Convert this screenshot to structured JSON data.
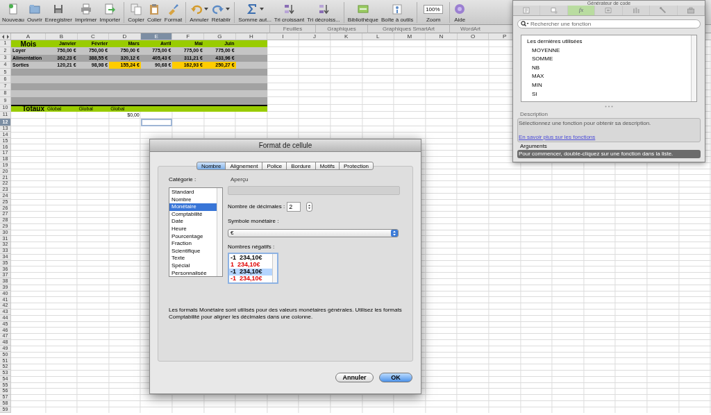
{
  "toolbar": {
    "buttons": [
      {
        "label": "Nouveau",
        "menu": false
      },
      {
        "label": "Ouvrir",
        "menu": false
      },
      {
        "label": "Enregistrer",
        "menu": false
      },
      {
        "label": "Imprimer",
        "menu": false
      },
      {
        "label": "Importer",
        "menu": false
      },
      {
        "label": "Copier",
        "menu": false
      },
      {
        "label": "Coller",
        "menu": false
      },
      {
        "label": "Format",
        "menu": false
      },
      {
        "label": "Annuler",
        "menu": true
      },
      {
        "label": "Rétablir",
        "menu": true
      },
      {
        "label": "Somme aut...",
        "menu": true
      },
      {
        "label": "Tri croissant",
        "menu": false
      },
      {
        "label": "Tri décroiss...",
        "menu": false
      },
      {
        "label": "Bibliothèque",
        "menu": false
      },
      {
        "label": "Boîte à outils",
        "menu": false
      }
    ],
    "zoom": {
      "label": "Zoom",
      "value": "100%"
    },
    "help": {
      "label": "Aide"
    }
  },
  "ribbon_tabs": [
    "Feuilles",
    "Graphiques",
    "Graphiques SmartArt",
    "WordArt"
  ],
  "sheet": {
    "columns": [
      {
        "label": "A",
        "selected": false
      },
      {
        "label": "B",
        "selected": false
      },
      {
        "label": "C",
        "selected": false
      },
      {
        "label": "D",
        "selected": false
      },
      {
        "label": "E",
        "selected": true
      },
      {
        "label": "F",
        "selected": false
      },
      {
        "label": "G",
        "selected": false
      },
      {
        "label": "H",
        "selected": false
      },
      {
        "label": "I",
        "selected": false
      },
      {
        "label": "J",
        "selected": false
      },
      {
        "label": "K",
        "selected": false
      },
      {
        "label": "L",
        "selected": false
      },
      {
        "label": "M",
        "selected": false
      },
      {
        "label": "N",
        "selected": false
      },
      {
        "label": "O",
        "selected": false
      },
      {
        "label": "P",
        "selected": false
      }
    ],
    "rows": [
      {
        "number": "1",
        "selected": false,
        "kind": "title",
        "cells": [
          {
            "text": "Mois",
            "highlighted": false
          },
          {
            "text": "Janvier",
            "highlighted": false
          },
          {
            "text": "Février",
            "highlighted": false
          },
          {
            "text": "Mars",
            "highlighted": false
          },
          {
            "text": "Avril",
            "highlighted": false
          },
          {
            "text": "Mai",
            "highlighted": false
          },
          {
            "text": "Juin",
            "highlighted": false
          }
        ]
      },
      {
        "number": "2",
        "selected": false,
        "kind": "light",
        "cells": [
          {
            "text": "Loyer",
            "highlighted": false
          },
          {
            "text": "750,00 €",
            "highlighted": false
          },
          {
            "text": "750,00 €",
            "highlighted": false
          },
          {
            "text": "750,00 €",
            "highlighted": false
          },
          {
            "text": "775,00 €",
            "highlighted": false
          },
          {
            "text": "775,00 €",
            "highlighted": false
          },
          {
            "text": "775,00 €",
            "highlighted": false
          }
        ]
      },
      {
        "number": "3",
        "selected": false,
        "kind": "dark",
        "cells": [
          {
            "text": "Alimentation",
            "highlighted": false
          },
          {
            "text": "362,23 €",
            "highlighted": false
          },
          {
            "text": "388,55 €",
            "highlighted": false
          },
          {
            "text": "320,12 €",
            "highlighted": false
          },
          {
            "text": "405,43 €",
            "highlighted": false
          },
          {
            "text": "311,21 €",
            "highlighted": false
          },
          {
            "text": "433,96 €",
            "highlighted": false
          }
        ]
      },
      {
        "number": "4",
        "selected": false,
        "kind": "light",
        "cells": [
          {
            "text": "Sorties",
            "highlighted": false
          },
          {
            "text": "120,21 €",
            "highlighted": false
          },
          {
            "text": "98,98 €",
            "highlighted": false
          },
          {
            "text": "155,24 €",
            "highlighted": true
          },
          {
            "text": "90,68 €",
            "highlighted": false
          },
          {
            "text": "162,93 €",
            "highlighted": true
          },
          {
            "text": "250,27 €",
            "highlighted": true
          }
        ]
      },
      {
        "number": "5",
        "selected": false,
        "kind": "dark"
      },
      {
        "number": "6",
        "selected": false,
        "kind": "light"
      },
      {
        "number": "7",
        "selected": false,
        "kind": "dark"
      },
      {
        "number": "8",
        "selected": false,
        "kind": "light"
      },
      {
        "number": "9",
        "selected": false,
        "kind": "dark"
      },
      {
        "number": "10",
        "selected": false,
        "kind": "total",
        "cells": [
          {
            "text": "Totaux",
            "highlighted": false
          },
          {
            "text": "Global",
            "highlighted": false
          },
          {
            "text": "Global",
            "highlighted": false
          },
          {
            "text": "Global",
            "highlighted": false
          }
        ]
      },
      {
        "number": "11",
        "selected": false,
        "kind": "result",
        "cells": [
          {
            "text": "$0,00",
            "highlighted": false
          }
        ]
      },
      {
        "number": "12",
        "selected": true,
        "kind": "plain"
      },
      {
        "number": "13",
        "selected": false,
        "kind": "plain"
      },
      {
        "number": "14",
        "selected": false,
        "kind": "plain"
      },
      {
        "number": "15",
        "selected": false,
        "kind": "plain"
      },
      {
        "number": "16",
        "selected": false,
        "kind": "plain"
      },
      {
        "number": "17",
        "selected": false,
        "kind": "plain"
      },
      {
        "number": "18",
        "selected": false,
        "kind": "plain"
      },
      {
        "number": "19",
        "selected": false,
        "kind": "plain"
      },
      {
        "number": "20",
        "selected": false,
        "kind": "plain"
      },
      {
        "number": "21",
        "selected": false,
        "kind": "plain"
      },
      {
        "number": "22",
        "selected": false,
        "kind": "plain"
      },
      {
        "number": "23",
        "selected": false,
        "kind": "plain"
      },
      {
        "number": "24",
        "selected": false,
        "kind": "plain"
      },
      {
        "number": "25",
        "selected": false,
        "kind": "plain"
      },
      {
        "number": "26",
        "selected": false,
        "kind": "plain"
      },
      {
        "number": "27",
        "selected": false,
        "kind": "plain"
      },
      {
        "number": "28",
        "selected": false,
        "kind": "plain"
      },
      {
        "number": "29",
        "selected": false,
        "kind": "plain"
      },
      {
        "number": "30",
        "selected": false,
        "kind": "plain"
      },
      {
        "number": "31",
        "selected": false,
        "kind": "plain"
      },
      {
        "number": "32",
        "selected": false,
        "kind": "plain"
      },
      {
        "number": "33",
        "selected": false,
        "kind": "plain"
      },
      {
        "number": "34",
        "selected": false,
        "kind": "plain"
      },
      {
        "number": "35",
        "selected": false,
        "kind": "plain"
      },
      {
        "number": "36",
        "selected": false,
        "kind": "plain"
      },
      {
        "number": "37",
        "selected": false,
        "kind": "plain"
      },
      {
        "number": "38",
        "selected": false,
        "kind": "plain"
      },
      {
        "number": "39",
        "selected": false,
        "kind": "plain"
      },
      {
        "number": "40",
        "selected": false,
        "kind": "plain"
      },
      {
        "number": "41",
        "selected": false,
        "kind": "plain"
      },
      {
        "number": "42",
        "selected": false,
        "kind": "plain"
      },
      {
        "number": "43",
        "selected": false,
        "kind": "plain"
      },
      {
        "number": "44",
        "selected": false,
        "kind": "plain"
      },
      {
        "number": "45",
        "selected": false,
        "kind": "plain"
      },
      {
        "number": "46",
        "selected": false,
        "kind": "plain"
      },
      {
        "number": "47",
        "selected": false,
        "kind": "plain"
      },
      {
        "number": "48",
        "selected": false,
        "kind": "plain"
      },
      {
        "number": "49",
        "selected": false,
        "kind": "plain"
      },
      {
        "number": "50",
        "selected": false,
        "kind": "plain"
      },
      {
        "number": "51",
        "selected": false,
        "kind": "plain"
      },
      {
        "number": "52",
        "selected": false,
        "kind": "plain"
      },
      {
        "number": "53",
        "selected": false,
        "kind": "plain"
      },
      {
        "number": "54",
        "selected": false,
        "kind": "plain"
      },
      {
        "number": "55",
        "selected": false,
        "kind": "plain"
      },
      {
        "number": "56",
        "selected": false,
        "kind": "plain"
      },
      {
        "number": "57",
        "selected": false,
        "kind": "plain"
      },
      {
        "number": "58",
        "selected": false,
        "kind": "plain"
      },
      {
        "number": "59",
        "selected": false,
        "kind": "plain"
      }
    ]
  },
  "dialog": {
    "title": "Format de cellule",
    "tabs": [
      {
        "label": "Nombre",
        "selected": true
      },
      {
        "label": "Alignement",
        "selected": false
      },
      {
        "label": "Police",
        "selected": false
      },
      {
        "label": "Bordure",
        "selected": false
      },
      {
        "label": "Motifs",
        "selected": false
      },
      {
        "label": "Protection",
        "selected": false
      }
    ],
    "category_label": "Catégorie :",
    "categories": [
      {
        "label": "Standard",
        "selected": false
      },
      {
        "label": "Nombre",
        "selected": false
      },
      {
        "label": "Monétaire",
        "selected": true
      },
      {
        "label": "Comptabilité",
        "selected": false
      },
      {
        "label": "Date",
        "selected": false
      },
      {
        "label": "Heure",
        "selected": false
      },
      {
        "label": "Pourcentage",
        "selected": false
      },
      {
        "label": "Fraction",
        "selected": false
      },
      {
        "label": "Scientifique",
        "selected": false
      },
      {
        "label": "Texte",
        "selected": false
      },
      {
        "label": "Spécial",
        "selected": false
      },
      {
        "label": "Personnalisée",
        "selected": false
      }
    ],
    "preview_label": "Aperçu",
    "decimals": {
      "label": "Nombre de décimales :",
      "value": "2"
    },
    "currency": {
      "label": "Symbole monétaire :",
      "value": "€"
    },
    "negatives": {
      "label": "Nombres négatifs :",
      "options": [
        {
          "text": "-1  234,10€",
          "color": "#000000",
          "selected": false
        },
        {
          "text": "1  234,10€",
          "color": "#e00000",
          "selected": false
        },
        {
          "text": "-1  234,10€",
          "color": "#000000",
          "selected": true
        },
        {
          "text": "-1  234,10€",
          "color": "#e00000",
          "selected": false
        }
      ]
    },
    "description": "Les formats Monétaire sont utilisés pour des valeurs monétaires générales. Utilisez les formats Comptabilité pour aligner les décimales dans une colonne.",
    "buttons": [
      {
        "label": "Annuler",
        "default": false
      },
      {
        "label": "OK",
        "default": true
      }
    ]
  },
  "code_panel": {
    "title": "Générateur de code",
    "tabs": [
      {
        "kind": "icon",
        "selected": false
      },
      {
        "kind": "icon",
        "selected": false
      },
      {
        "kind": "text",
        "label": "fx",
        "selected": true
      },
      {
        "kind": "icon",
        "selected": false
      },
      {
        "kind": "icon",
        "selected": false
      },
      {
        "kind": "icon",
        "selected": false
      },
      {
        "kind": "icon",
        "selected": false
      }
    ],
    "search": {
      "placeholder": "Rechercher une fonction"
    },
    "list_heading": "Les dernières utilisées",
    "functions": [
      "MOYENNE",
      "SOMME",
      "NB",
      "MAX",
      "MIN",
      "SI"
    ],
    "description_label": "Description",
    "description": "Sélectionnez une fonction pour obtenir sa description.",
    "link": "En savoir plus sur les fonctions",
    "arguments_label": "Arguments",
    "arguments_hint": "Pour commencer, double-cliquez sur une fonction dans la liste."
  }
}
